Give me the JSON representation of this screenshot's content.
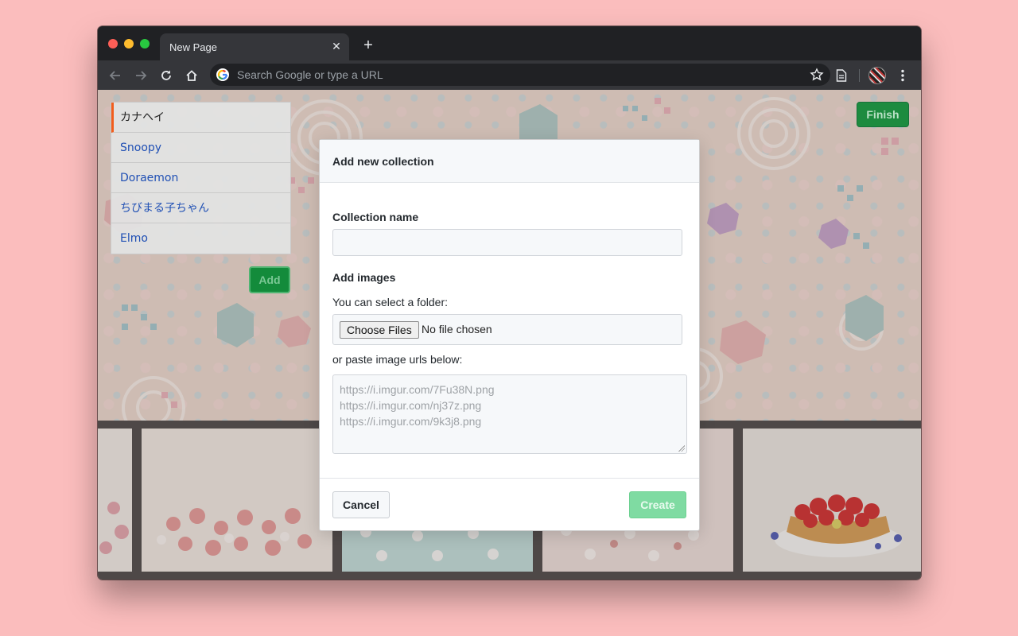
{
  "browser": {
    "tab_title": "New Page",
    "omnibox_placeholder": "Search Google or type a URL"
  },
  "sidebar": {
    "items": [
      {
        "label": "カナヘイ",
        "active": true
      },
      {
        "label": "Snoopy",
        "active": false
      },
      {
        "label": "Doraemon",
        "active": false
      },
      {
        "label": "ちびまる子ちゃん",
        "active": false
      },
      {
        "label": "Elmo",
        "active": false
      }
    ],
    "add_label": "Add"
  },
  "header": {
    "finish_label": "Finish"
  },
  "modal": {
    "title": "Add new collection",
    "name_label": "Collection name",
    "name_value": "",
    "images_label": "Add images",
    "folder_hint": "You can select a folder:",
    "file_button": "Choose Files",
    "file_status": "No file chosen",
    "urls_hint": "or paste image urls below:",
    "urls_placeholder": "https://i.imgur.com/7Fu38N.png\nhttps://i.imgur.com/nj37z.png\nhttps://i.imgur.com/9k3j8.png",
    "cancel_label": "Cancel",
    "create_label": "Create"
  },
  "colors": {
    "page_background": "#fbbdbd",
    "finish_green": "#1d8b3f",
    "create_green": "#7fdba2",
    "active_marker": "#f25d1d",
    "link_blue": "#1f4fb4"
  },
  "icons": [
    "back-arrow-icon",
    "forward-arrow-icon",
    "reload-icon",
    "home-icon",
    "google-icon",
    "bookmark-star-icon",
    "reading-list-icon",
    "profile-avatar",
    "kebab-menu-icon",
    "close-icon",
    "plus-icon"
  ]
}
